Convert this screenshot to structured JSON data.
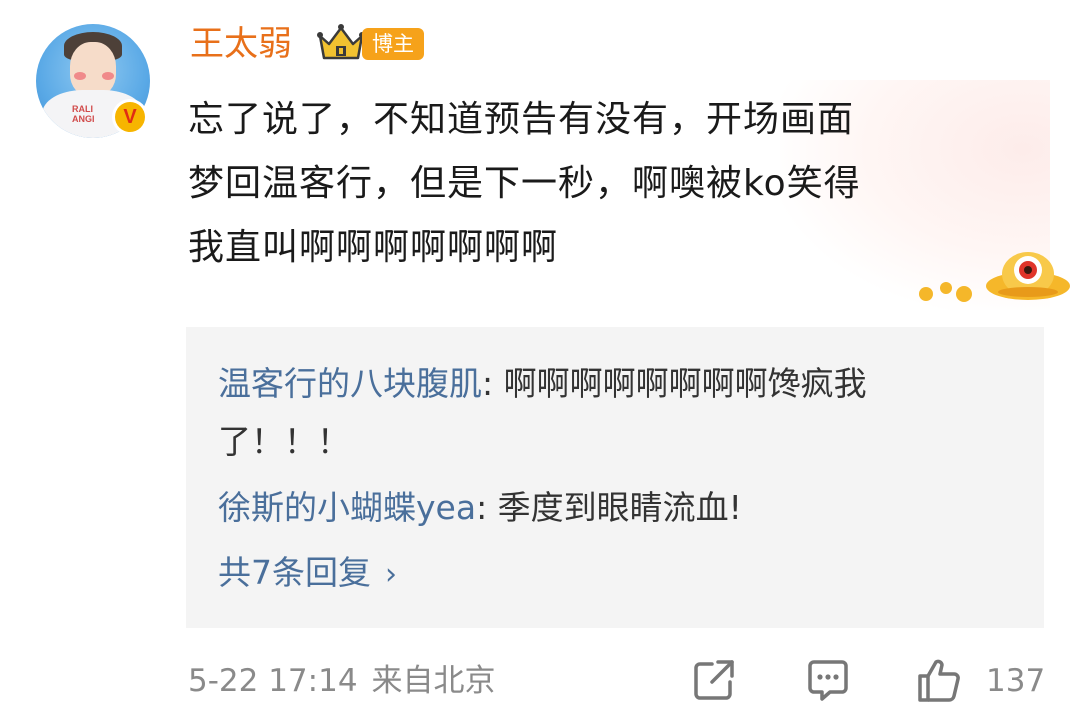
{
  "post": {
    "username": "王太弱",
    "badge_label": "博主",
    "verified_mark": "V",
    "avatar_shirt_text_1": "RALI",
    "avatar_shirt_text_2": "ANGI",
    "comment_line_1": "忘了说了，不知道预告有没有，开场画面",
    "comment_line_2": "梦回温客行，但是下一秒，啊噢被ko笑得",
    "comment_line_3": "我直叫啊啊啊啊啊啊啊"
  },
  "replies": [
    {
      "author": "温客行的八块腹肌",
      "separator": ": ",
      "text_line_1": "啊啊啊啊啊啊啊啊馋疯我",
      "text_line_2": "了！！！"
    },
    {
      "author": "徐斯的小蝴蝶yea",
      "separator": ": ",
      "text_line_1": "季度到眼睛流血!"
    }
  ],
  "more_replies": {
    "label": "共7条回复",
    "chevron": "›"
  },
  "footer": {
    "timestamp": "5-22 17:14",
    "source": "来自北京",
    "like_count": "137",
    "icons": [
      "share-icon",
      "comment-icon",
      "like-icon"
    ]
  },
  "colors": {
    "username": "#e8701a",
    "badge": "#f6a21a",
    "reply_author": "#4a6f9b",
    "reply_bg": "#f4f4f4",
    "meta": "#8a8a8a"
  }
}
